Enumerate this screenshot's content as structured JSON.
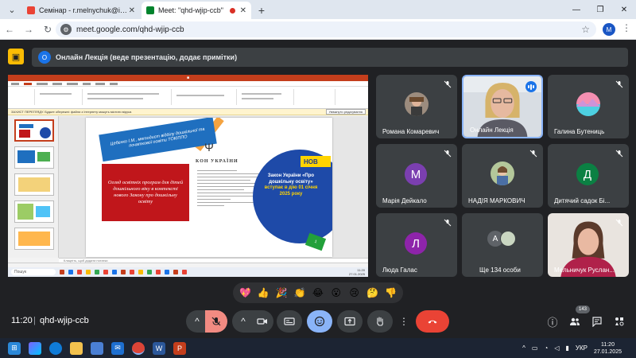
{
  "browser": {
    "tabs": [
      {
        "title": "Семінар - r.melnychuk@ippo.kubg.edu.ua",
        "active": false
      },
      {
        "title": "Meet: \"qhd-wjip-ccb\"",
        "active": true
      }
    ],
    "url": "meet.google.com/qhd-wjip-ccb",
    "profile_initial": "M"
  },
  "meet": {
    "presenter_banner": "Онлайн Лекція (веде презентацію, додає примітки)",
    "presenter_initial": "О",
    "time": "11:20",
    "separator": "|",
    "meeting_code": "qhd-wjip-ccb",
    "participant_count": "143"
  },
  "slide": {
    "banner_text": "Цебєнко І.М., методист відділу дошкільної та початкової освіти ТОКІППО",
    "red_box_text": "Огляд освітніх програм для дітей дошкільного віку в контексті нового Закону про дошкільну освіту",
    "law_heading": "КОН УКРАЇНИ",
    "circle_title": "Закон України «Про дошкільну освіту»",
    "circle_subtitle": "вступає в дію 01 січня 2025 року",
    "new_tag": "НОВ",
    "green_num": "1"
  },
  "ppt": {
    "notice": "ЗАХИСТ ПЕРЕГЛЯДУ. Будьте обережні: файли з Інтернету можуть містити віруси.",
    "notice_button": "Увімкнути редагування",
    "notes": "Клацніть, щоб додати нотатки",
    "search": "Пошук",
    "tray_time": "11:20",
    "tray_date": "27.01.2025"
  },
  "participants": [
    {
      "name": "Романа Комаревич",
      "kind": "photo",
      "muted": true
    },
    {
      "name": "Онлайн Лекція",
      "kind": "video",
      "speaking": true
    },
    {
      "name": "Галина Бутениць",
      "kind": "photo",
      "muted": true
    },
    {
      "name": "Марія Дейкало",
      "kind": "letter",
      "letter": "М",
      "color": "#7b3fb0",
      "muted": true
    },
    {
      "name": "НАДІЯ МАРКОВИЧ",
      "kind": "photo",
      "muted": true
    },
    {
      "name": "Дитячий садок Бі...",
      "kind": "letter",
      "letter": "Д",
      "color": "#0b8043",
      "muted": true
    },
    {
      "name": "Люда Галас",
      "kind": "letter",
      "letter": "Л",
      "color": "#8e24aa",
      "muted": true
    },
    {
      "name": "Ще 134 особи",
      "kind": "more",
      "letter": "А"
    },
    {
      "name": "Мельничук Руслан...",
      "kind": "video2",
      "muted": true
    }
  ],
  "reactions": [
    "💖",
    "👍",
    "🎉",
    "👏",
    "😂",
    "😮",
    "😢",
    "🤔",
    "👎"
  ],
  "taskbar": {
    "lang": "УКР",
    "time": "11:20",
    "date": "27.01.2025"
  }
}
